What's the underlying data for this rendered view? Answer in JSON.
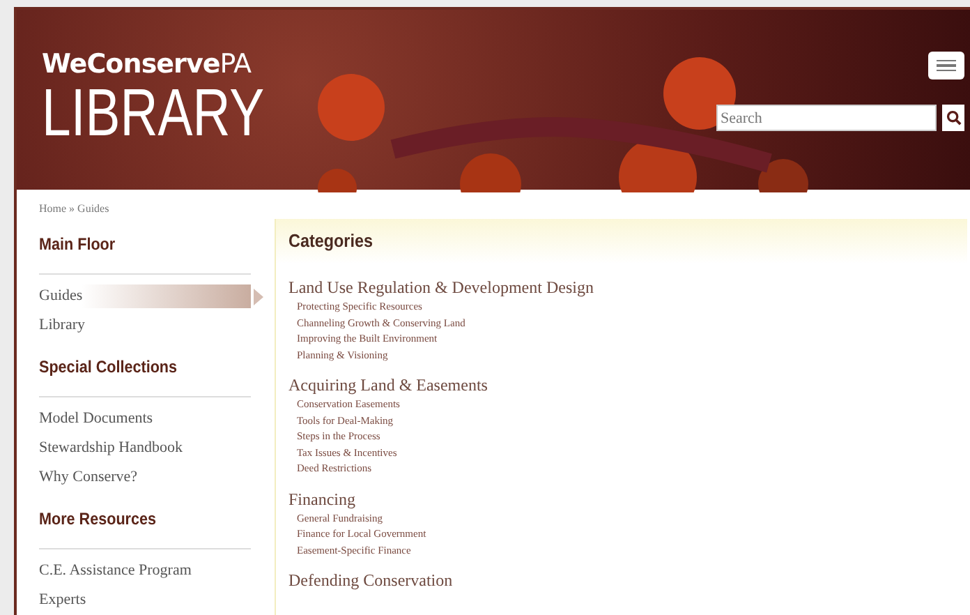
{
  "header": {
    "logo_top": "**WeConserve**PA",
    "logo_bottom": "LIBRARY",
    "search": {
      "placeholder": "Search"
    }
  },
  "breadcrumb": "Home » Guides",
  "sidebar": [
    {
      "heading": "Main Floor",
      "items": [
        {
          "label": "Guides",
          "selected": true
        },
        {
          "label": "Library",
          "selected": false
        }
      ]
    },
    {
      "heading": "Special Collections",
      "items": [
        {
          "label": "Model Documents",
          "selected": false
        },
        {
          "label": "Stewardship Handbook",
          "selected": false
        },
        {
          "label": "Why Conserve?",
          "selected": false
        }
      ]
    },
    {
      "heading": "More Resources",
      "items": [
        {
          "label": "C.E. Assistance Program",
          "selected": false
        },
        {
          "label": "Experts",
          "selected": false
        }
      ]
    }
  ],
  "main": {
    "title": "Categories",
    "groups": [
      {
        "heading": "Land Use Regulation & Development Design",
        "items": [
          "Protecting Specific Resources",
          "Channeling Growth & Conserving Land",
          "Improving the Built Environment",
          "Planning & Visioning"
        ]
      },
      {
        "heading": "Acquiring Land & Easements",
        "items": [
          "Conservation Easements",
          "Tools for Deal-Making",
          "Steps in the Process",
          "Tax Issues & Incentives",
          "Deed Restrictions"
        ]
      },
      {
        "heading": "Financing",
        "items": [
          "General Fundraising",
          "Finance for Local Government",
          "Easement-Specific Finance"
        ]
      },
      {
        "heading": "Defending Conservation"
      }
    ]
  }
}
